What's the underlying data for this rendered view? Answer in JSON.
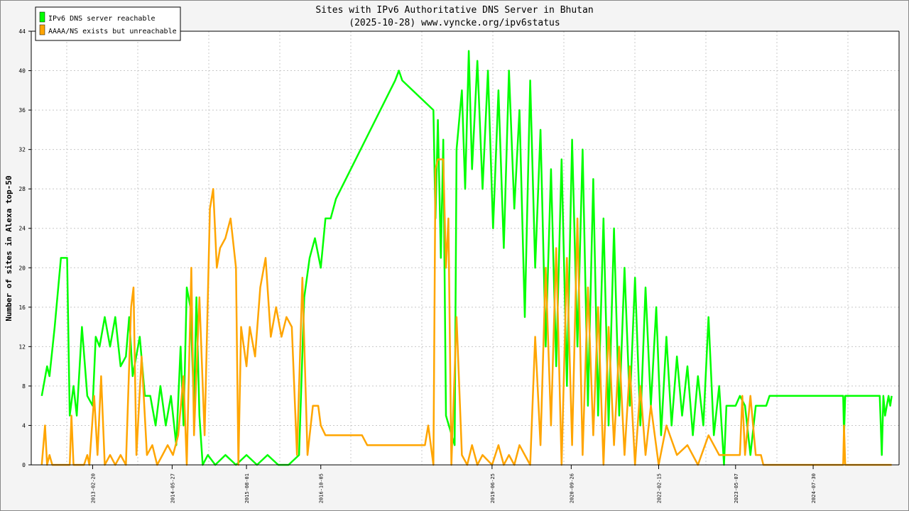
{
  "chart_data": {
    "type": "line",
    "title": "Sites with IPv6 Authoritative DNS Server in Bhutan",
    "subtitle": "(2025-10-28) www.vyncke.org/ipv6status",
    "ylabel": "Number of sites in Alexa top-50",
    "xlabel": "",
    "ylim": [
      0,
      44
    ],
    "yticks": [
      0,
      4,
      8,
      12,
      16,
      20,
      24,
      28,
      32,
      36,
      40,
      44
    ],
    "xlim": [
      "2012-03-01",
      "2025-12-10"
    ],
    "xticks": [
      "2013-02-20",
      "2014-05-27",
      "2015-08-01",
      "2016-10-05",
      "2019-06-25",
      "2020-09-26",
      "2022-02-15",
      "2023-05-07",
      "2024-07-30"
    ],
    "grid": true,
    "legend_position": "top-left",
    "series": [
      {
        "name": "IPv6 DNS server reachable",
        "color": "#00ff00",
        "points": [
          [
            "2012-05-01",
            7
          ],
          [
            "2012-06-01",
            10
          ],
          [
            "2012-06-15",
            9
          ],
          [
            "2012-07-15",
            14
          ],
          [
            "2012-08-20",
            21
          ],
          [
            "2012-09-25",
            21
          ],
          [
            "2012-10-10",
            5
          ],
          [
            "2012-11-01",
            8
          ],
          [
            "2012-11-20",
            5
          ],
          [
            "2012-12-20",
            14
          ],
          [
            "2013-01-20",
            7
          ],
          [
            "2013-02-20",
            6
          ],
          [
            "2013-03-10",
            13
          ],
          [
            "2013-04-01",
            12
          ],
          [
            "2013-05-01",
            15
          ],
          [
            "2013-06-01",
            12
          ],
          [
            "2013-07-01",
            15
          ],
          [
            "2013-08-01",
            10
          ],
          [
            "2013-09-01",
            11
          ],
          [
            "2013-09-20",
            15
          ],
          [
            "2013-10-10",
            9
          ],
          [
            "2013-11-20",
            13
          ],
          [
            "2013-12-20",
            7
          ],
          [
            "2014-01-20",
            7
          ],
          [
            "2014-02-20",
            4
          ],
          [
            "2014-03-20",
            8
          ],
          [
            "2014-04-20",
            4
          ],
          [
            "2014-05-20",
            7
          ],
          [
            "2014-06-20",
            2
          ],
          [
            "2014-07-15",
            12
          ],
          [
            "2014-08-01",
            4
          ],
          [
            "2014-08-20",
            18
          ],
          [
            "2014-09-10",
            16
          ],
          [
            "2014-10-01",
            6
          ],
          [
            "2014-10-15",
            17
          ],
          [
            "2014-11-01",
            5
          ],
          [
            "2014-11-20",
            0
          ],
          [
            "2014-12-20",
            1
          ],
          [
            "2015-02-01",
            0
          ],
          [
            "2015-04-01",
            1
          ],
          [
            "2015-06-01",
            0
          ],
          [
            "2015-08-01",
            1
          ],
          [
            "2015-10-01",
            0
          ],
          [
            "2015-12-01",
            1
          ],
          [
            "2016-02-01",
            0
          ],
          [
            "2016-04-01",
            0
          ],
          [
            "2016-06-01",
            1
          ],
          [
            "2016-07-01",
            17
          ],
          [
            "2016-08-01",
            21
          ],
          [
            "2016-09-01",
            23
          ],
          [
            "2016-10-05",
            20
          ],
          [
            "2016-11-01",
            25
          ],
          [
            "2016-12-01",
            25
          ],
          [
            "2017-01-01",
            27
          ],
          [
            "2017-12-10",
            39
          ],
          [
            "2018-01-01",
            40
          ],
          [
            "2018-01-20",
            39
          ],
          [
            "2018-07-20",
            36
          ],
          [
            "2018-08-01",
            25
          ],
          [
            "2018-08-15",
            35
          ],
          [
            "2018-09-01",
            21
          ],
          [
            "2018-09-15",
            33
          ],
          [
            "2018-10-01",
            5
          ],
          [
            "2018-11-20",
            2
          ],
          [
            "2018-12-01",
            32
          ],
          [
            "2019-01-01",
            38
          ],
          [
            "2019-01-20",
            28
          ],
          [
            "2019-02-10",
            42
          ],
          [
            "2019-03-01",
            30
          ],
          [
            "2019-04-01",
            41
          ],
          [
            "2019-05-01",
            28
          ],
          [
            "2019-06-01",
            40
          ],
          [
            "2019-07-01",
            24
          ],
          [
            "2019-08-01",
            38
          ],
          [
            "2019-09-01",
            22
          ],
          [
            "2019-10-01",
            40
          ],
          [
            "2019-11-01",
            26
          ],
          [
            "2019-12-01",
            36
          ],
          [
            "2020-01-01",
            15
          ],
          [
            "2020-02-01",
            39
          ],
          [
            "2020-03-01",
            20
          ],
          [
            "2020-04-01",
            34
          ],
          [
            "2020-05-01",
            12
          ],
          [
            "2020-06-01",
            30
          ],
          [
            "2020-07-01",
            10
          ],
          [
            "2020-08-01",
            31
          ],
          [
            "2020-09-01",
            8
          ],
          [
            "2020-10-01",
            33
          ],
          [
            "2020-11-01",
            12
          ],
          [
            "2020-12-01",
            32
          ],
          [
            "2021-01-01",
            6
          ],
          [
            "2021-02-01",
            29
          ],
          [
            "2021-03-01",
            5
          ],
          [
            "2021-04-01",
            25
          ],
          [
            "2021-05-01",
            4
          ],
          [
            "2021-06-01",
            24
          ],
          [
            "2021-07-01",
            5
          ],
          [
            "2021-08-01",
            20
          ],
          [
            "2021-09-01",
            6
          ],
          [
            "2021-10-01",
            19
          ],
          [
            "2021-11-01",
            4
          ],
          [
            "2021-12-01",
            18
          ],
          [
            "2022-01-01",
            6
          ],
          [
            "2022-02-01",
            16
          ],
          [
            "2022-03-01",
            3
          ],
          [
            "2022-04-01",
            13
          ],
          [
            "2022-05-01",
            4
          ],
          [
            "2022-06-01",
            11
          ],
          [
            "2022-07-01",
            5
          ],
          [
            "2022-08-01",
            10
          ],
          [
            "2022-09-01",
            3
          ],
          [
            "2022-10-01",
            9
          ],
          [
            "2022-11-01",
            4
          ],
          [
            "2022-12-01",
            15
          ],
          [
            "2023-01-01",
            3
          ],
          [
            "2023-02-01",
            8
          ],
          [
            "2023-03-01",
            0
          ],
          [
            "2023-03-15",
            6
          ],
          [
            "2023-05-07",
            6
          ],
          [
            "2023-06-01",
            7
          ],
          [
            "2023-07-01",
            6
          ],
          [
            "2023-08-01",
            1
          ],
          [
            "2023-09-01",
            6
          ],
          [
            "2023-10-01",
            6
          ],
          [
            "2023-11-01",
            6
          ],
          [
            "2023-11-20",
            7
          ],
          [
            "2024-07-30",
            7
          ],
          [
            "2025-01-20",
            7
          ],
          [
            "2025-01-25",
            3
          ],
          [
            "2025-02-01",
            7
          ],
          [
            "2025-08-20",
            7
          ],
          [
            "2025-09-01",
            1
          ],
          [
            "2025-09-10",
            7
          ],
          [
            "2025-09-20",
            5
          ],
          [
            "2025-10-10",
            7
          ],
          [
            "2025-10-20",
            6
          ],
          [
            "2025-10-28",
            7
          ]
        ]
      },
      {
        "name": "AAAA/NS exists but unreachable",
        "color": "#ffa500",
        "points": [
          [
            "2012-05-01",
            0
          ],
          [
            "2012-05-20",
            4
          ],
          [
            "2012-06-01",
            0
          ],
          [
            "2012-06-15",
            1
          ],
          [
            "2012-07-01",
            0
          ],
          [
            "2012-10-10",
            0
          ],
          [
            "2012-10-20",
            5
          ],
          [
            "2012-11-01",
            0
          ],
          [
            "2013-01-01",
            0
          ],
          [
            "2013-01-20",
            1
          ],
          [
            "2013-02-01",
            0
          ],
          [
            "2013-03-01",
            7
          ],
          [
            "2013-03-20",
            1
          ],
          [
            "2013-04-10",
            9
          ],
          [
            "2013-05-01",
            0
          ],
          [
            "2013-06-01",
            1
          ],
          [
            "2013-07-01",
            0
          ],
          [
            "2013-08-01",
            1
          ],
          [
            "2013-09-01",
            0
          ],
          [
            "2013-10-01",
            16
          ],
          [
            "2013-10-15",
            18
          ],
          [
            "2013-11-01",
            1
          ],
          [
            "2013-12-01",
            11
          ],
          [
            "2014-01-01",
            1
          ],
          [
            "2014-02-01",
            2
          ],
          [
            "2014-03-01",
            0
          ],
          [
            "2014-04-01",
            1
          ],
          [
            "2014-05-01",
            2
          ],
          [
            "2014-06-01",
            1
          ],
          [
            "2014-07-01",
            3
          ],
          [
            "2014-08-01",
            9
          ],
          [
            "2014-08-20",
            0
          ],
          [
            "2014-09-15",
            20
          ],
          [
            "2014-10-01",
            3
          ],
          [
            "2014-11-01",
            17
          ],
          [
            "2014-12-01",
            3
          ],
          [
            "2015-01-01",
            26
          ],
          [
            "2015-01-20",
            28
          ],
          [
            "2015-02-10",
            20
          ],
          [
            "2015-03-01",
            22
          ],
          [
            "2015-04-01",
            23
          ],
          [
            "2015-05-01",
            25
          ],
          [
            "2015-06-01",
            20
          ],
          [
            "2015-06-15",
            0
          ],
          [
            "2015-07-01",
            14
          ],
          [
            "2015-08-01",
            10
          ],
          [
            "2015-08-20",
            14
          ],
          [
            "2015-09-20",
            11
          ],
          [
            "2015-10-20",
            18
          ],
          [
            "2015-11-20",
            21
          ],
          [
            "2015-12-20",
            13
          ],
          [
            "2016-01-20",
            16
          ],
          [
            "2016-02-20",
            13
          ],
          [
            "2016-03-20",
            15
          ],
          [
            "2016-04-20",
            14
          ],
          [
            "2016-05-20",
            1
          ],
          [
            "2016-06-20",
            19
          ],
          [
            "2016-07-20",
            1
          ],
          [
            "2016-08-20",
            6
          ],
          [
            "2016-09-20",
            6
          ],
          [
            "2016-10-05",
            4
          ],
          [
            "2016-11-01",
            3
          ],
          [
            "2017-06-01",
            3
          ],
          [
            "2017-07-01",
            2
          ],
          [
            "2018-06-01",
            2
          ],
          [
            "2018-06-20",
            4
          ],
          [
            "2018-07-20",
            0
          ],
          [
            "2018-08-01",
            30
          ],
          [
            "2018-08-15",
            31
          ],
          [
            "2018-09-15",
            31
          ],
          [
            "2018-10-01",
            20
          ],
          [
            "2018-10-15",
            25
          ],
          [
            "2018-11-01",
            0
          ],
          [
            "2018-12-01",
            15
          ],
          [
            "2019-01-01",
            1
          ],
          [
            "2019-02-01",
            0
          ],
          [
            "2019-03-01",
            2
          ],
          [
            "2019-04-01",
            0
          ],
          [
            "2019-05-01",
            1
          ],
          [
            "2019-06-25",
            0
          ],
          [
            "2019-08-01",
            2
          ],
          [
            "2019-09-01",
            0
          ],
          [
            "2019-10-01",
            1
          ],
          [
            "2019-11-01",
            0
          ],
          [
            "2019-12-01",
            2
          ],
          [
            "2020-01-01",
            1
          ],
          [
            "2020-02-01",
            0
          ],
          [
            "2020-03-01",
            13
          ],
          [
            "2020-04-01",
            2
          ],
          [
            "2020-05-01",
            20
          ],
          [
            "2020-06-01",
            4
          ],
          [
            "2020-07-01",
            22
          ],
          [
            "2020-08-01",
            0
          ],
          [
            "2020-09-01",
            21
          ],
          [
            "2020-10-01",
            2
          ],
          [
            "2020-11-01",
            25
          ],
          [
            "2020-12-01",
            1
          ],
          [
            "2021-01-01",
            18
          ],
          [
            "2021-02-01",
            3
          ],
          [
            "2021-03-01",
            16
          ],
          [
            "2021-04-01",
            0
          ],
          [
            "2021-05-01",
            14
          ],
          [
            "2021-06-01",
            2
          ],
          [
            "2021-07-01",
            12
          ],
          [
            "2021-08-01",
            1
          ],
          [
            "2021-09-01",
            10
          ],
          [
            "2021-10-01",
            0
          ],
          [
            "2021-11-01",
            8
          ],
          [
            "2021-12-01",
            1
          ],
          [
            "2022-01-01",
            6
          ],
          [
            "2022-02-15",
            0
          ],
          [
            "2022-04-01",
            4
          ],
          [
            "2022-06-01",
            1
          ],
          [
            "2022-08-01",
            2
          ],
          [
            "2022-10-01",
            0
          ],
          [
            "2022-12-01",
            3
          ],
          [
            "2023-02-01",
            1
          ],
          [
            "2023-03-01",
            1
          ],
          [
            "2023-06-01",
            1
          ],
          [
            "2023-06-15",
            7
          ],
          [
            "2023-07-01",
            1
          ],
          [
            "2023-08-01",
            7
          ],
          [
            "2023-09-01",
            1
          ],
          [
            "2023-10-01",
            1
          ],
          [
            "2023-10-15",
            0
          ],
          [
            "2025-01-20",
            0
          ],
          [
            "2025-01-25",
            4
          ],
          [
            "2025-02-01",
            0
          ],
          [
            "2025-10-28",
            0
          ]
        ]
      }
    ]
  }
}
